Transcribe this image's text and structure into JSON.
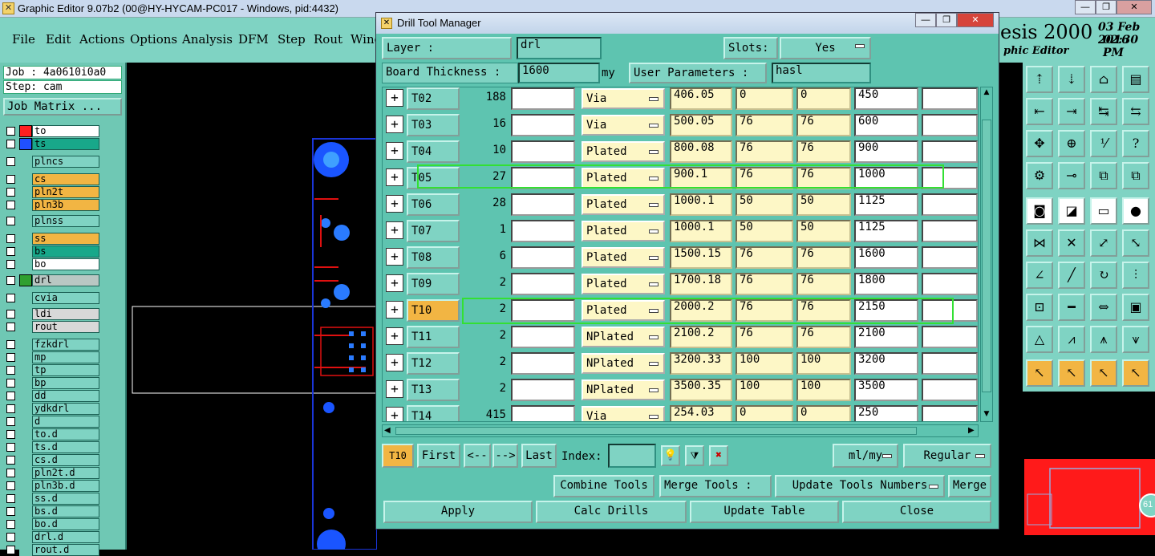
{
  "window": {
    "title": "Graphic Editor 9.07b2 (00@HY-HYCAM-PC017 - Windows, pid:4432)"
  },
  "menu": [
    "File",
    "Edit",
    "Actions",
    "Options",
    "Analysis",
    "DFM",
    "Step",
    "Rout",
    "Wind"
  ],
  "logo": {
    "brand": "esis 2000",
    "sub": "phic Editor",
    "date": "03 Feb 2016",
    "time": "02:30 PM"
  },
  "job": {
    "job_label": "Job : 4a0610i0a0",
    "step_label": "Step: cam",
    "matrix_btn": "Job Matrix ..."
  },
  "layers": [
    {
      "name": "to",
      "color": "#ff2020",
      "bg": "#ffffff"
    },
    {
      "name": "ts",
      "color": "#2050ff",
      "bg": "#18a88a"
    },
    {
      "name": "plncs",
      "color": "",
      "bg": "#7fd3c3"
    },
    {
      "name": "cs",
      "color": "",
      "bg": "#f2b543"
    },
    {
      "name": "pln2t",
      "color": "",
      "bg": "#f2b543"
    },
    {
      "name": "pln3b",
      "color": "",
      "bg": "#f2b543"
    },
    {
      "name": "plnss",
      "color": "",
      "bg": "#7fd3c3"
    },
    {
      "name": "ss",
      "color": "",
      "bg": "#f2b543"
    },
    {
      "name": "bs",
      "color": "",
      "bg": "#18a88a"
    },
    {
      "name": "bo",
      "color": "",
      "bg": "#ffffff"
    },
    {
      "name": "drl",
      "color": "#30a030",
      "bg": "#b9c7c3"
    },
    {
      "name": "cvia",
      "color": "",
      "bg": "#7fd3c3"
    },
    {
      "name": "ldi",
      "color": "",
      "bg": "#d8d8d8"
    },
    {
      "name": "rout",
      "color": "",
      "bg": "#d8d8d8"
    },
    {
      "name": "fzkdrl",
      "color": "",
      "bg": "#7fd3c3"
    },
    {
      "name": "mp",
      "color": "",
      "bg": "#7fd3c3"
    },
    {
      "name": "tp",
      "color": "",
      "bg": "#7fd3c3"
    },
    {
      "name": "bp",
      "color": "",
      "bg": "#7fd3c3"
    },
    {
      "name": "dd",
      "color": "",
      "bg": "#7fd3c3"
    },
    {
      "name": "ydkdrl",
      "color": "",
      "bg": "#7fd3c3"
    },
    {
      "name": "d",
      "color": "",
      "bg": "#7fd3c3"
    },
    {
      "name": "to.d",
      "color": "",
      "bg": "#7fd3c3"
    },
    {
      "name": "ts.d",
      "color": "",
      "bg": "#7fd3c3"
    },
    {
      "name": "cs.d",
      "color": "",
      "bg": "#7fd3c3"
    },
    {
      "name": "pln2t.d",
      "color": "",
      "bg": "#7fd3c3"
    },
    {
      "name": "pln3b.d",
      "color": "",
      "bg": "#7fd3c3"
    },
    {
      "name": "ss.d",
      "color": "",
      "bg": "#7fd3c3"
    },
    {
      "name": "bs.d",
      "color": "",
      "bg": "#7fd3c3"
    },
    {
      "name": "bo.d",
      "color": "",
      "bg": "#7fd3c3"
    },
    {
      "name": "drl.d",
      "color": "",
      "bg": "#7fd3c3"
    },
    {
      "name": "rout.d",
      "color": "",
      "bg": "#7fd3c3"
    }
  ],
  "dialog": {
    "title": "Drill Tool Manager",
    "layer_label": "Layer          :",
    "layer_value": "drl",
    "slots_label": "Slots:",
    "slots_value": "Yes",
    "thickness_label": "Board Thickness :",
    "thickness_value": "1600",
    "thickness_unit": "my",
    "userparam_label": "User Parameters :",
    "userparam_value": "hasl",
    "rows": [
      {
        "tool": "T02",
        "count": "188",
        "type": "Via",
        "v1": "406.05",
        "v2": "0",
        "v3": "0",
        "v4": "450"
      },
      {
        "tool": "T03",
        "count": "16",
        "type": "Via",
        "v1": "500.05",
        "v2": "76",
        "v3": "76",
        "v4": "600"
      },
      {
        "tool": "T04",
        "count": "10",
        "type": "Plated",
        "v1": "800.08",
        "v2": "76",
        "v3": "76",
        "v4": "900"
      },
      {
        "tool": "T05",
        "count": "27",
        "type": "Plated",
        "v1": "900.1",
        "v2": "76",
        "v3": "76",
        "v4": "1000"
      },
      {
        "tool": "T06",
        "count": "28",
        "type": "Plated",
        "v1": "1000.1",
        "v2": "50",
        "v3": "50",
        "v4": "1125"
      },
      {
        "tool": "T07",
        "count": "1",
        "type": "Plated",
        "v1": "1000.1",
        "v2": "50",
        "v3": "50",
        "v4": "1125"
      },
      {
        "tool": "T08",
        "count": "6",
        "type": "Plated",
        "v1": "1500.15",
        "v2": "76",
        "v3": "76",
        "v4": "1600"
      },
      {
        "tool": "T09",
        "count": "2",
        "type": "Plated",
        "v1": "1700.18",
        "v2": "76",
        "v3": "76",
        "v4": "1800"
      },
      {
        "tool": "T10",
        "count": "2",
        "type": "Plated",
        "v1": "2000.2",
        "v2": "76",
        "v3": "76",
        "v4": "2150"
      },
      {
        "tool": "T11",
        "count": "2",
        "type": "NPlated",
        "v1": "2100.2",
        "v2": "76",
        "v3": "76",
        "v4": "2100"
      },
      {
        "tool": "T12",
        "count": "2",
        "type": "NPlated",
        "v1": "3200.33",
        "v2": "100",
        "v3": "100",
        "v4": "3200"
      },
      {
        "tool": "T13",
        "count": "2",
        "type": "NPlated",
        "v1": "3500.35",
        "v2": "100",
        "v3": "100",
        "v4": "3500"
      },
      {
        "tool": "T14",
        "count": "415",
        "type": "Via",
        "v1": "254.03",
        "v2": "0",
        "v3": "0",
        "v4": "250"
      }
    ],
    "selected_tool": "T10",
    "nav": {
      "current": "T10",
      "first": "First",
      "prev": "<--",
      "next": "-->",
      "last": "Last",
      "index_label": "Index:",
      "units": "ml/my",
      "mode": "Regular"
    },
    "actions": {
      "combine": "Combine Tools",
      "merge_label": "Merge Tools :",
      "update_numbers": "Update Tools Numbers",
      "merge": "Merge"
    },
    "bottom": {
      "apply": "Apply",
      "calc": "Calc Drills",
      "update": "Update Table",
      "close": "Close"
    }
  },
  "mini_badge": "61"
}
